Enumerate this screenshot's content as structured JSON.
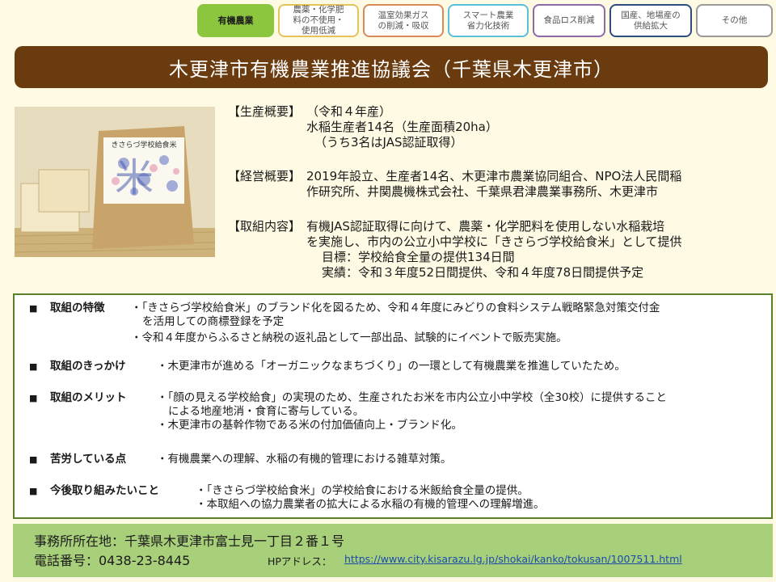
{
  "tabs": [
    {
      "label": "有機農業",
      "active": true
    },
    {
      "label": "農薬・化学肥\n料の不使用・\n使用低減",
      "active": false
    },
    {
      "label": "温室効果ガス\nの削減・吸収",
      "active": false
    },
    {
      "label": "スマート農業\n省力化技術",
      "active": false
    },
    {
      "label": "食品ロス削減",
      "active": false
    },
    {
      "label": "国産、地場産の\n供給拡大",
      "active": false
    },
    {
      "label": "その他",
      "active": false
    }
  ],
  "tab_colors": [
    "#8cc63f",
    "#e6c25a",
    "#d98a5a",
    "#5bbfd6",
    "#8f6aa8",
    "#2d4d7a",
    "#9a9a9a"
  ],
  "title": "木更津市有機農業推進協議会（千葉県木更津市）",
  "photo": {
    "bag_label": "きさらづ学校給食米",
    "bag_kanji": "米"
  },
  "overview": {
    "production_head": "【生産概要】",
    "production_lines": [
      "（令和４年産）",
      "水稲生産者14名（生産面積20ha）",
      "（うち3名はJAS認証取得）"
    ],
    "management_head": "【経営概要】",
    "management_lines": [
      "2019年設立、生産者14名、木更津市農業協同組合、NPO法人民間稲",
      "作研究所、井関農機株式会社、千葉県君津農業事務所、木更津市"
    ],
    "activity_head": "【取組内容】",
    "activity_lines": [
      "有機JAS認証取得に向けて、農薬・化学肥料を使用しない水稲栽培",
      "を実施し、市内の公立小中学校に「きさらづ学校給食米」として提供",
      "目標：学校給食全量の提供134日間",
      "実績：令和３年度52日間提供、令和４年度78日間提供予定"
    ]
  },
  "details": [
    {
      "label": "取組の特徴",
      "lines": [
        "・「きさらづ学校給食米」のブランド化を図るため、令和４年度にみどりの食料システム戦略緊急対策交付金",
        "を活用しての商標登録を予定",
        "・令和４年度からふるさと納税の返礼品として一部出品、試験的にイベントで販売実施。"
      ]
    },
    {
      "label": "取組のきっかけ",
      "lines": [
        "・木更津市が進める「オーガニックなまちづくり」の一環として有機農業を推進していたため。"
      ]
    },
    {
      "label": "取組のメリット",
      "lines": [
        "・「顔の見える学校給食」の実現のため、生産されたお米を市内公立小中学校（全30校）に提供すること",
        "による地産地消・食育に寄与している。",
        "・木更津市の基幹作物である米の付加価値向上・ブランド化。"
      ]
    },
    {
      "label": "苦労している点",
      "lines": [
        "・有機農業への理解、水稲の有機的管理における雑草対策。"
      ]
    },
    {
      "label": "今後取り組みたいこと",
      "lines": [
        "・「きさらづ学校給食米」の学校給食における米飯給食全量の提供。",
        "・本取組への協力農業者の拡大による水稲の有機的管理への理解増進。"
      ]
    }
  ],
  "bullet": "■",
  "footer": {
    "address": "事務所所在地：千葉県木更津市富士見一丁目２番１号",
    "phone": "電話番号：0438-23-8445",
    "hp_label": "HPアドレス：",
    "hp_url": "https://www.city.kisarazu.lg.jp/shokai/kanko/tokusan/1007511.html"
  }
}
